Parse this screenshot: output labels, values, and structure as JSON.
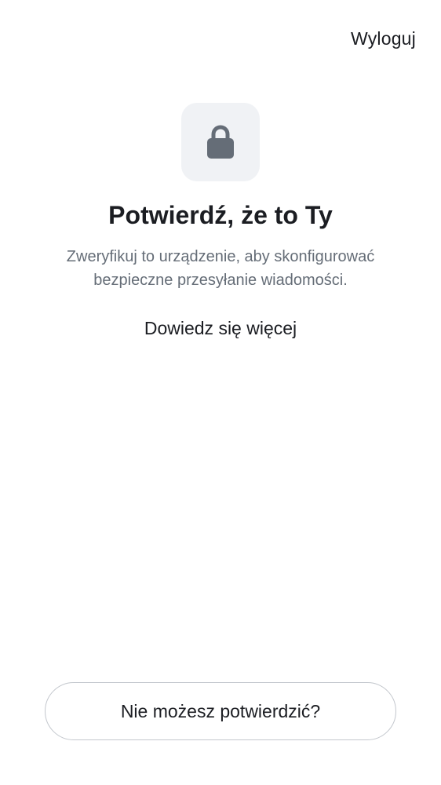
{
  "header": {
    "signout_label": "Wyloguj"
  },
  "icon": {
    "name": "lock-icon",
    "color": "#656d77",
    "tile_color": "#f0f2f5"
  },
  "main": {
    "title": "Potwierdź, że to Ty",
    "subtitle_line1": "Zweryfikuj to urządzenie, aby skonfigurować",
    "subtitle_line2": "bezpieczne przesyłanie wiadomości.",
    "learn_more_label": "Dowiedz się więcej"
  },
  "footer": {
    "cant_confirm_label": "Nie możesz potwierdzić?"
  }
}
